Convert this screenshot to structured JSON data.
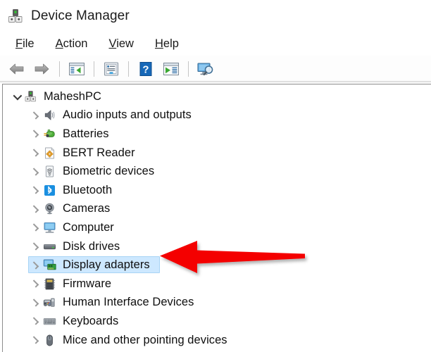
{
  "window": {
    "title": "Device Manager",
    "icon": "device-manager-icon"
  },
  "menubar": {
    "items": [
      {
        "label": "File",
        "accel": "F",
        "rest": "ile"
      },
      {
        "label": "Action",
        "accel": "A",
        "rest": "ction"
      },
      {
        "label": "View",
        "accel": "V",
        "rest": "iew"
      },
      {
        "label": "Help",
        "accel": "H",
        "rest": "elp"
      }
    ]
  },
  "toolbar": {
    "buttons": [
      {
        "name": "back-button",
        "icon": "back-arrow-icon",
        "tooltip": "Back"
      },
      {
        "name": "forward-button",
        "icon": "forward-arrow-icon",
        "tooltip": "Forward"
      },
      {
        "name": "show-hide-tree-button",
        "icon": "console-tree-icon",
        "tooltip": "Show/Hide Console Tree"
      },
      {
        "name": "properties-button",
        "icon": "properties-window-icon",
        "tooltip": "Properties"
      },
      {
        "name": "help-button",
        "icon": "help-question-icon",
        "tooltip": "Help"
      },
      {
        "name": "update-driver-button",
        "icon": "update-driver-icon",
        "tooltip": "Update Driver Software"
      },
      {
        "name": "scan-hardware-button",
        "icon": "scan-hardware-changes-icon",
        "tooltip": "Scan for hardware changes"
      }
    ]
  },
  "tree": {
    "root": {
      "label": "MaheshPC",
      "icon": "computer-device-icon",
      "expanded": true
    },
    "items": [
      {
        "label": "Audio inputs and outputs",
        "icon": "speaker-icon",
        "selected": false
      },
      {
        "label": "Batteries",
        "icon": "battery-icon",
        "selected": false
      },
      {
        "label": "BERT Reader",
        "icon": "bert-reader-icon",
        "selected": false
      },
      {
        "label": "Biometric devices",
        "icon": "fingerprint-icon",
        "selected": false
      },
      {
        "label": "Bluetooth",
        "icon": "bluetooth-icon",
        "selected": false
      },
      {
        "label": "Cameras",
        "icon": "camera-icon",
        "selected": false
      },
      {
        "label": "Computer",
        "icon": "monitor-icon",
        "selected": false
      },
      {
        "label": "Disk drives",
        "icon": "disk-drive-icon",
        "selected": false
      },
      {
        "label": "Display adapters",
        "icon": "display-adapter-icon",
        "selected": true
      },
      {
        "label": "Firmware",
        "icon": "firmware-chip-icon",
        "selected": false
      },
      {
        "label": "Human Interface Devices",
        "icon": "gamepad-hid-icon",
        "selected": false
      },
      {
        "label": "Keyboards",
        "icon": "keyboard-icon",
        "selected": false
      },
      {
        "label": "Mice and other pointing devices",
        "icon": "mouse-icon",
        "selected": false
      }
    ]
  },
  "annotation": {
    "arrow": {
      "name": "red-pointer-arrow",
      "color": "#f40000",
      "points_to": "Display adapters",
      "direction": "left"
    }
  },
  "colors": {
    "selection_fill": "#cde8ff",
    "selection_border": "#a8d4f5",
    "text": "#0f0f0f",
    "annotation_red": "#f40000"
  }
}
